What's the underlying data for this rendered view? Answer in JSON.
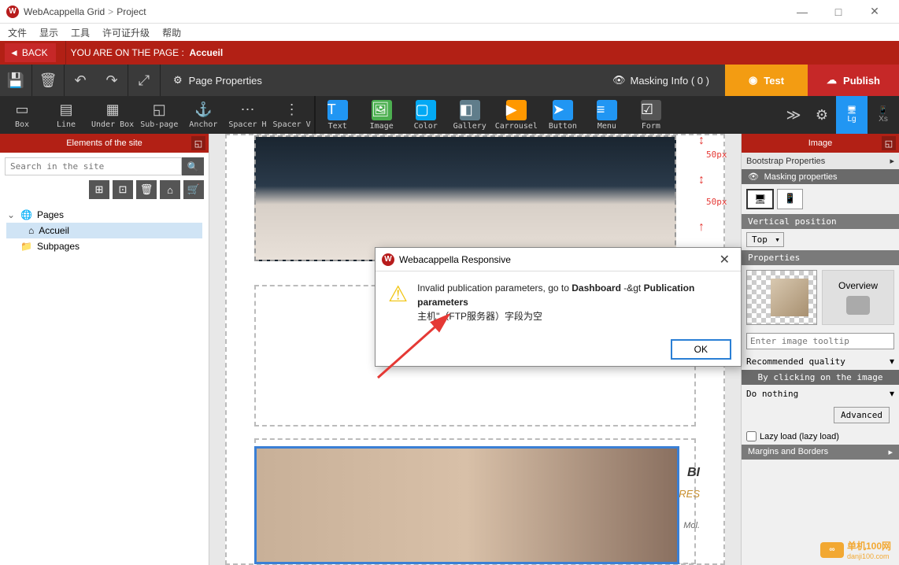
{
  "titlebar": {
    "app": "WebAcappella Grid",
    "crumb": "Project"
  },
  "menu": [
    "文件",
    "显示",
    "工具",
    "许可证升级",
    "帮助"
  ],
  "redbar": {
    "back": "BACK",
    "prefix": "YOU ARE ON THE PAGE :",
    "page": "Accueil"
  },
  "tb1": {
    "pageprops": "Page Properties",
    "mask": "Masking Info ( 0 )",
    "test": "Test",
    "publish": "Publish"
  },
  "tb2": {
    "items": [
      {
        "lbl": "Box",
        "ico": "▭"
      },
      {
        "lbl": "Line",
        "ico": "▤"
      },
      {
        "lbl": "Under Box",
        "ico": "▦"
      },
      {
        "lbl": "Sub-page",
        "ico": "◱"
      },
      {
        "lbl": "Anchor",
        "ico": "⚓"
      },
      {
        "lbl": "Spacer H",
        "ico": "⋯"
      },
      {
        "lbl": "Spacer V",
        "ico": "⋮"
      }
    ],
    "items2": [
      {
        "lbl": "Text",
        "ico": "T",
        "bg": "#2196f3"
      },
      {
        "lbl": "Image",
        "ico": "🖼",
        "bg": "#4caf50"
      },
      {
        "lbl": "Color",
        "ico": "▢",
        "bg": "#03a9f4"
      },
      {
        "lbl": "Gallery",
        "ico": "◧",
        "bg": "#607d8b"
      },
      {
        "lbl": "Carrousel",
        "ico": "▶",
        "bg": "#ff9800"
      },
      {
        "lbl": "Button",
        "ico": "➤",
        "bg": "#2196f3"
      },
      {
        "lbl": "Menu",
        "ico": "≡",
        "bg": "#2196f3"
      },
      {
        "lbl": "Form",
        "ico": "☑",
        "bg": "#555"
      }
    ],
    "lg": "Lg",
    "xs": "Xs"
  },
  "left": {
    "hdr": "Elements of the site",
    "search_ph": "Search in the site",
    "tree": {
      "pages": "Pages",
      "accueil": "Accueil",
      "subpages": "Subpages"
    }
  },
  "canvas": {
    "px50": "50px",
    "txt1": "BI",
    "txt2": "RES",
    "txt3": "Mol."
  },
  "right": {
    "hdr": "Image",
    "bootstrap": "Bootstrap Properties",
    "masking": "Masking properties",
    "vpos": "Vertical position",
    "vpos_val": "Top",
    "props": "Properties",
    "overview": "Overview",
    "tooltip_ph": "Enter image tooltip",
    "quality": "Recommended quality",
    "clicking": "By clicking on the image",
    "donothing": "Do nothing",
    "advanced": "Advanced",
    "lazy": "Lazy load (lazy load)",
    "margins": "Margins and Borders"
  },
  "dialog": {
    "title": "Webacappella Responsive",
    "msg_pre": "Invalid publication parameters, go to ",
    "msg_b1": "Dashboard",
    "msg_mid": " -&gt ",
    "msg_b2": "Publication parameters",
    "msg2": "主机\"（FTP服务器）字段为空",
    "ok": "OK"
  },
  "watermark": {
    "text": "单机100网",
    "url": "danji100.com"
  }
}
